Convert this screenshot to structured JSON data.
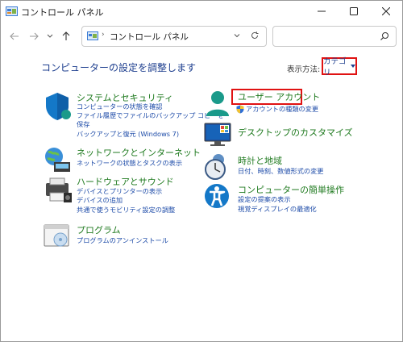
{
  "window": {
    "title": "コントロール パネル",
    "minimize_label": "minimize",
    "maximize_label": "maximize",
    "close_label": "close"
  },
  "nav": {
    "breadcrumb": "コントロール パネル",
    "search_placeholder": ""
  },
  "main": {
    "heading": "コンピューターの設定を調整します",
    "view_by_label": "表示方法:",
    "view_by_value": "カテゴリ"
  },
  "categories": {
    "system": {
      "title": "システムとセキュリティ",
      "links": [
        "コンピューターの状態を確認",
        "ファイル履歴でファイルのバックアップ コピーを",
        "保存",
        "バックアップと復元 (Windows 7)"
      ]
    },
    "network": {
      "title": "ネットワークとインターネット",
      "links": [
        "ネットワークの状態とタスクの表示"
      ]
    },
    "hardware": {
      "title": "ハードウェアとサウンド",
      "links": [
        "デバイスとプリンターの表示",
        "デバイスの追加",
        "共通で使うモビリティ設定の調整"
      ]
    },
    "programs": {
      "title": "プログラム",
      "links": [
        "プログラムのアンインストール"
      ]
    },
    "user": {
      "title": "ユーザー アカウント",
      "links": [
        "アカウントの種類の変更"
      ]
    },
    "appearance": {
      "title": "デスクトップのカスタマイズ",
      "links": []
    },
    "clock": {
      "title": "時計と地域",
      "links": [
        "日付、時刻、数値形式の変更"
      ]
    },
    "ease": {
      "title": "コンピューターの簡単操作",
      "links": [
        "設定の提案の表示",
        "視覚ディスプレイの最適化"
      ]
    }
  },
  "colors": {
    "title_green": "#1f7a1f",
    "link_blue": "#1d4ba8",
    "highlight_red": "#e01212"
  }
}
